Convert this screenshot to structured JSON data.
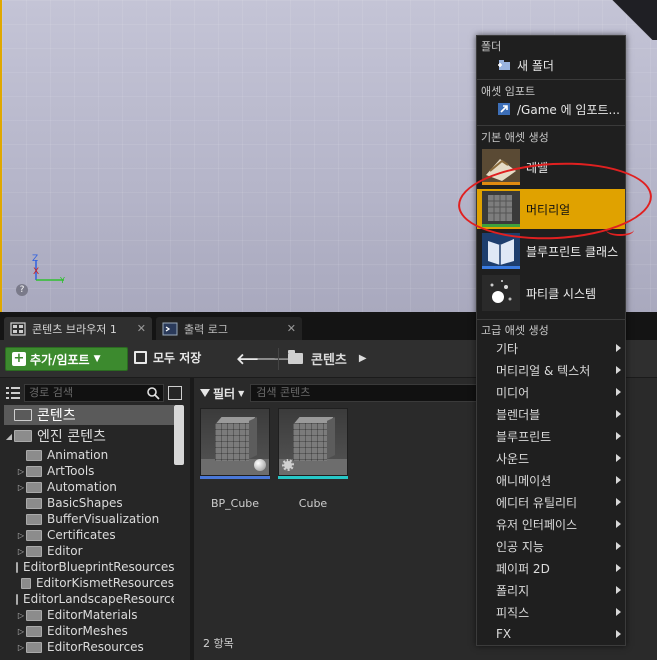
{
  "tabs": [
    {
      "label": "콘텐츠 브라우저 1",
      "active": true
    },
    {
      "label": "출력 로그",
      "active": false
    }
  ],
  "toolbar": {
    "add_import": "추가/임포트",
    "save_all": "모두 저장",
    "path": "콘텐츠"
  },
  "left_panel": {
    "search_placeholder": "경로 검색",
    "tree": [
      {
        "label": "콘텐츠",
        "level": 0,
        "selected": true
      },
      {
        "label": "엔진 콘텐츠",
        "level": 0,
        "expanded": true
      },
      {
        "label": "Animation",
        "level": 1,
        "has_children": false
      },
      {
        "label": "ArtTools",
        "level": 1,
        "has_children": true
      },
      {
        "label": "Automation",
        "level": 1,
        "has_children": true
      },
      {
        "label": "BasicShapes",
        "level": 1,
        "has_children": false
      },
      {
        "label": "BufferVisualization",
        "level": 1,
        "has_children": false
      },
      {
        "label": "Certificates",
        "level": 1,
        "has_children": true
      },
      {
        "label": "Editor",
        "level": 1,
        "has_children": true
      },
      {
        "label": "EditorBlueprintResources",
        "level": 1,
        "has_children": false
      },
      {
        "label": "EditorKismetResources",
        "level": 1,
        "has_children": false
      },
      {
        "label": "EditorLandscapeResources",
        "level": 1,
        "has_children": false
      },
      {
        "label": "EditorMaterials",
        "level": 1,
        "has_children": true
      },
      {
        "label": "EditorMeshes",
        "level": 1,
        "has_children": true
      },
      {
        "label": "EditorResources",
        "level": 1,
        "has_children": true
      }
    ]
  },
  "content": {
    "filter_label": "필터",
    "search_placeholder": "검색 콘텐츠",
    "assets": [
      {
        "name": "BP_Cube",
        "accent": "#4a78d8"
      },
      {
        "name": "Cube",
        "accent": "#27c7c7"
      }
    ],
    "item_count": "2 항목"
  },
  "context_menu": {
    "sections": {
      "folder": "폴더",
      "asset_import": "애셋 임포트",
      "basic_asset": "기본 애셋 생성",
      "advanced_asset": "고급 애셋 생성"
    },
    "new_folder": "새 폴더",
    "import_to": "/Game 에 임포트...",
    "basic_items": [
      {
        "label": "레벨",
        "highlighted": false
      },
      {
        "label": "머티리얼",
        "highlighted": true
      },
      {
        "label": "블루프린트 클래스",
        "highlighted": false
      },
      {
        "label": "파티클 시스템",
        "highlighted": false
      }
    ],
    "advanced_items": [
      "기타",
      "머티리얼 & 텍스처",
      "미디어",
      "블렌더블",
      "블루프린트",
      "사운드",
      "애니메이션",
      "에디터 유틸리티",
      "유저 인터페이스",
      "인공 지능",
      "페이퍼 2D",
      "폴리지",
      "피직스",
      "FX"
    ]
  },
  "colors": {
    "highlight": "#e0a200",
    "green_button": "#3c8a2e",
    "annotation": "#e02020"
  }
}
